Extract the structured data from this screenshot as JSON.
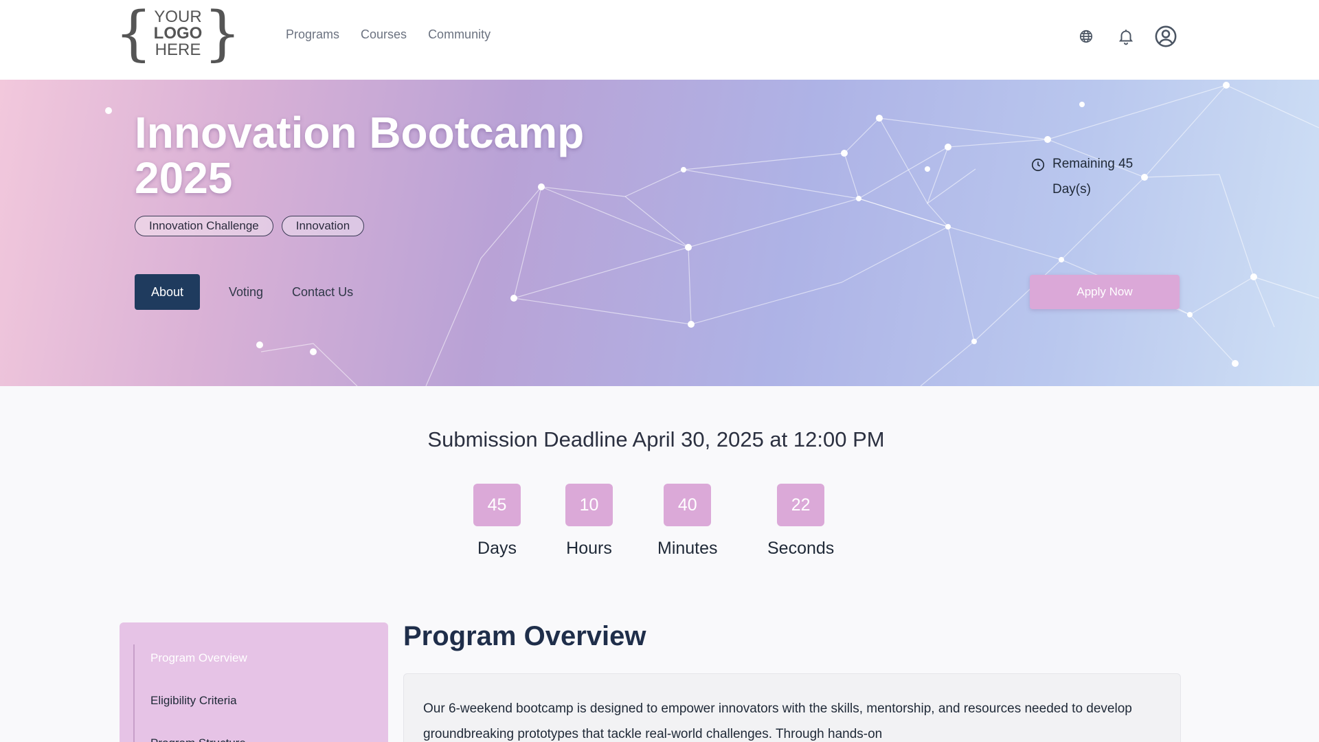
{
  "logo": {
    "line1": "YOUR",
    "line2": "LOGO",
    "line3": "HERE"
  },
  "nav": {
    "programs": "Programs",
    "courses": "Courses",
    "community": "Community"
  },
  "header_icons": [
    "globe-icon",
    "bell-icon",
    "user-icon"
  ],
  "hero": {
    "title": "Innovation Bootcamp 2025",
    "tags": [
      "Innovation Challenge",
      "Innovation"
    ],
    "tabs": {
      "about": "About",
      "voting": "Voting",
      "contact": "Contact Us"
    },
    "remaining": "Remaining 45 Day(s)",
    "apply_label": "Apply Now"
  },
  "deadline": "Submission Deadline April 30, 2025 at 12:00 PM",
  "countdown": {
    "days": {
      "value": "45",
      "label": "Days"
    },
    "hours": {
      "value": "10",
      "label": "Hours"
    },
    "minutes": {
      "value": "40",
      "label": "Minutes"
    },
    "seconds": {
      "value": "22",
      "label": "Seconds"
    }
  },
  "sidebar": {
    "items": [
      "Program Overview",
      "Eligibility Criteria",
      "Program Structure"
    ]
  },
  "overview": {
    "title": "Program Overview",
    "body": "Our 6-weekend bootcamp is designed to empower innovators with the skills, mentorship, and resources needed to develop groundbreaking prototypes that tackle real-world challenges. Through hands-on"
  },
  "colors": {
    "accent": "#dba9d8",
    "active_tab": "#1f3b5e",
    "sidebar_bg": "#e6c3e6"
  }
}
